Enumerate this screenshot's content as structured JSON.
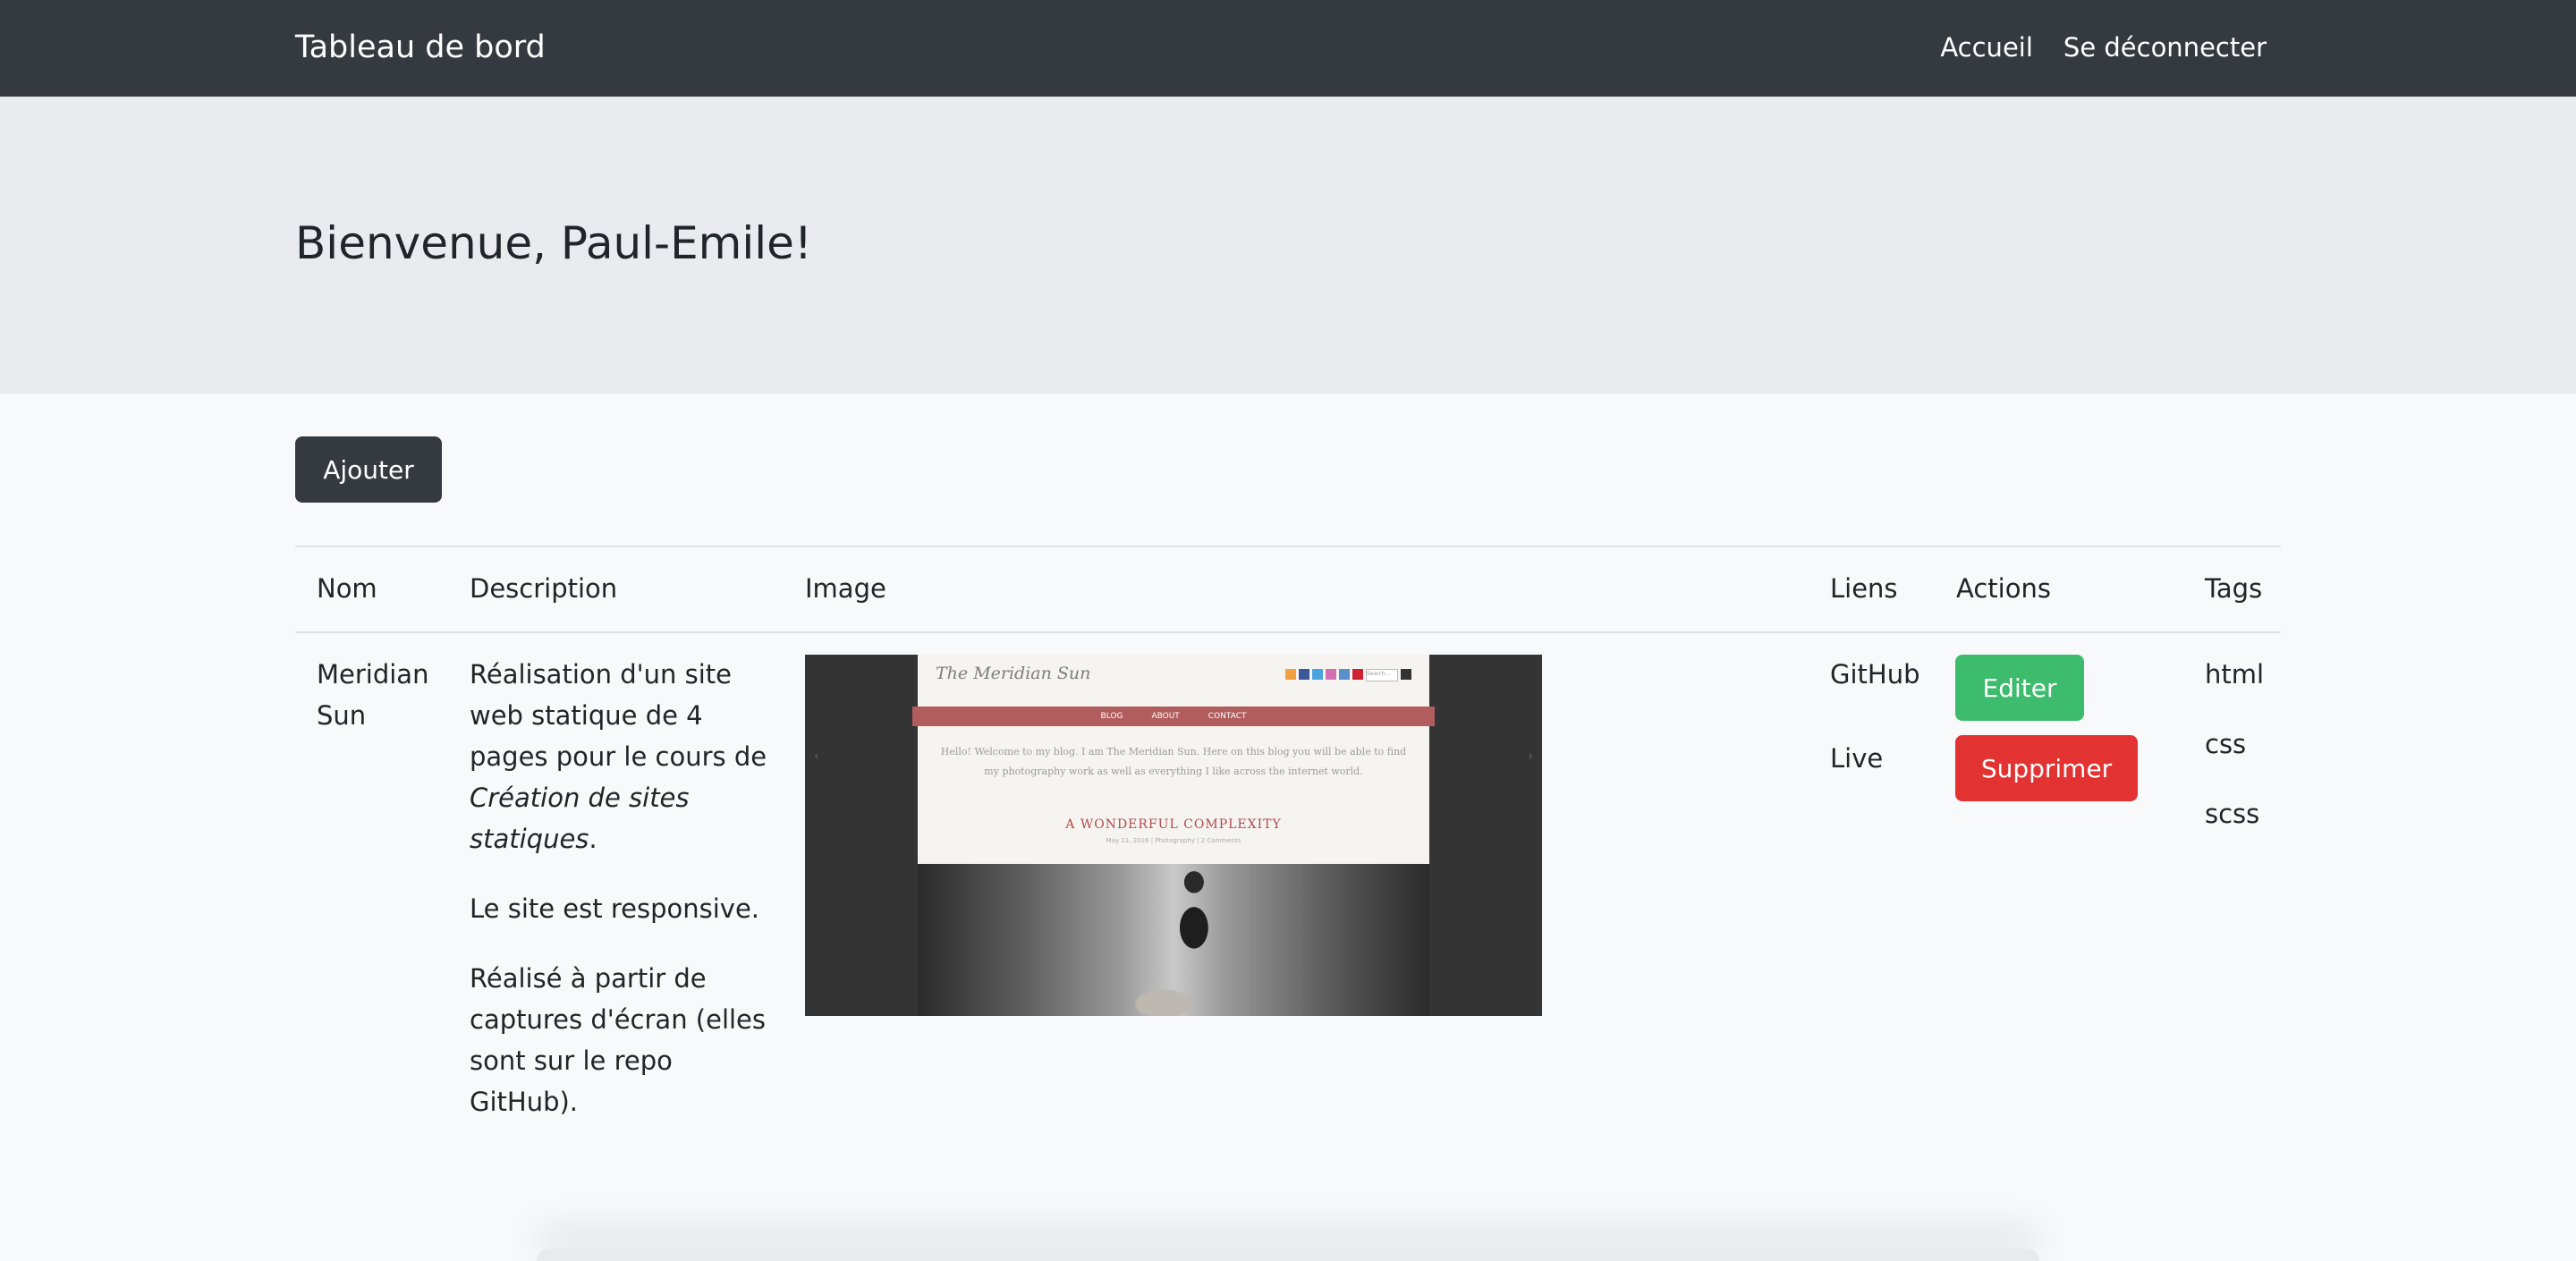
{
  "navbar": {
    "brand": "Tableau de bord",
    "links": [
      "Accueil",
      "Se déconnecter"
    ]
  },
  "hero": {
    "title": "Bienvenue, Paul-Emile!"
  },
  "toolbar": {
    "add_label": "Ajouter"
  },
  "table": {
    "headers": [
      "Nom",
      "Description",
      "Image",
      "Liens",
      "Actions",
      "Tags"
    ],
    "rows": [
      {
        "name": "Meridian Sun",
        "description": {
          "p1_start": "Réalisation d'un site web statique de 4 pages pour le cours de ",
          "p1_em": "Création de sites statiques",
          "p1_end": ".",
          "p2": "Le site est responsive.",
          "p3": "Réalisé à partir de captures d'écran (elles sont sur le repo GitHub)."
        },
        "image": {
          "site_title": "The Meridian Sun",
          "menu": [
            "BLOG",
            "ABOUT",
            "CONTACT"
          ],
          "intro": "Hello! Welcome to my blog. I am The Meridian Sun. Here on this blog you will be able to find my photography work as well as everything I like across the internet world.",
          "post_title": "A WONDERFUL COMPLEXITY",
          "post_meta": "May 11, 2016 | Photography | 2 Comments",
          "search_placeholder": "Search..."
        },
        "links": [
          "GitHub",
          "Live"
        ],
        "actions": {
          "edit": "Editer",
          "delete": "Supprimer"
        },
        "tags": [
          "html",
          "css",
          "scss"
        ]
      }
    ]
  },
  "colors": {
    "navbar": "#343a40",
    "hero": "#e9ebee",
    "edit": "#3cbc6c",
    "delete": "#e23232"
  }
}
